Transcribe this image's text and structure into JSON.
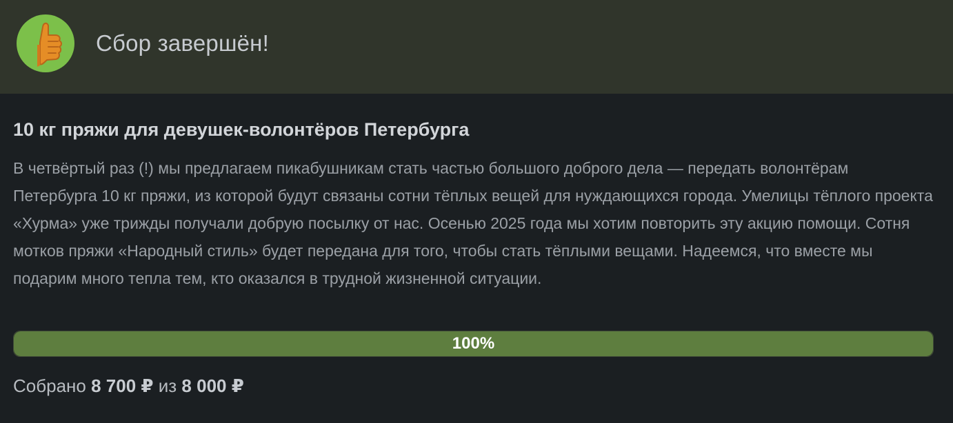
{
  "header": {
    "title": "Сбор завершён!",
    "icon": "thumbs-up-icon"
  },
  "campaign": {
    "title": "10 кг пряжи для девушек-волонтёров Петербурга",
    "description": "В четвёртый раз (!) мы предлагаем пикабушникам стать частью большого доброго дела — передать волонтёрам Петербурга 10 кг пряжи, из которой будут связаны сотни тёплых вещей для нуждающихся города. Умелицы тёплого проекта «Хурма» уже трижды получали добрую посылку от нас. Осенью 2025 года мы хотим повторить эту акцию помощи. Сотня мотков пряжи «Народный стиль» будет передана для того, чтобы стать тёплыми вещами. Надеемся, что вместе мы подарим много тепла тем, кто оказался в трудной жизненной ситуации."
  },
  "progress": {
    "label": "100%",
    "fraction": 1.0,
    "fill_color": "#5e7e3f"
  },
  "amount": {
    "prefix": "Собрано",
    "collected": "8 700 ₽",
    "separator": "из",
    "goal": "8 000 ₽"
  },
  "colors": {
    "header_bg": "#30352b",
    "page_bg": "#1b1f22",
    "icon_circle": "#7cc04a",
    "icon_hand": "#e08a2a"
  }
}
